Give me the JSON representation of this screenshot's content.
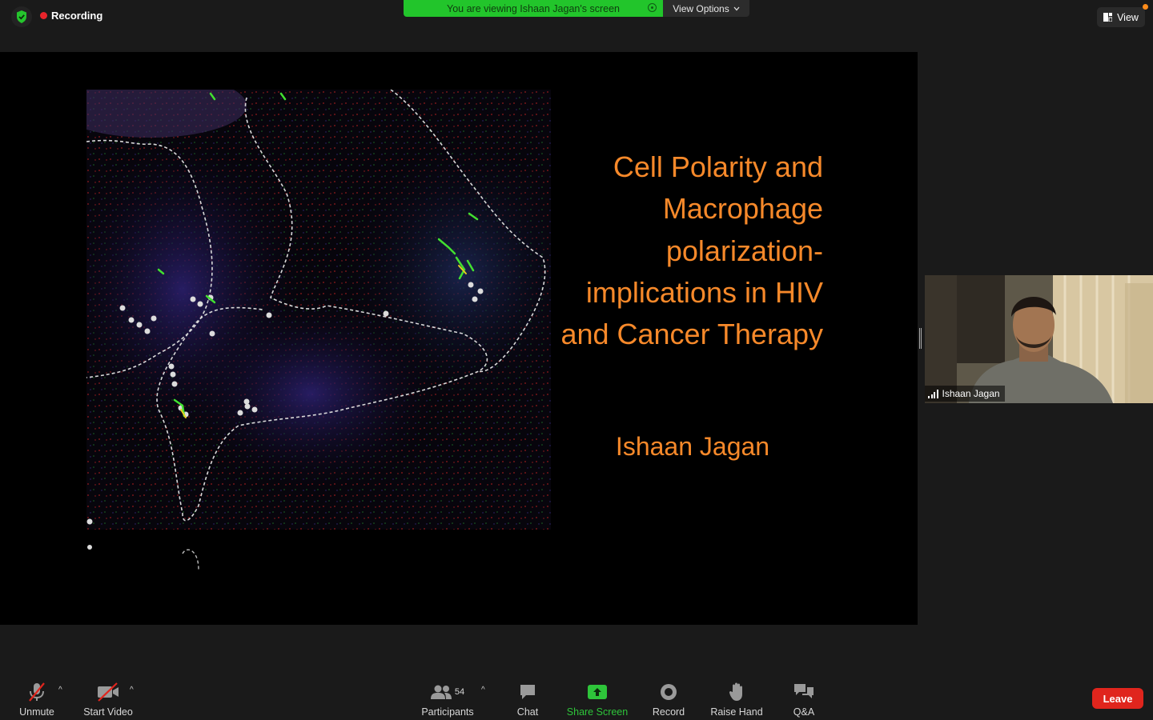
{
  "topbar": {
    "recording_label": "Recording",
    "viewing_banner": "You are viewing Ishaan Jagan's screen",
    "view_options_label": "View Options",
    "view_button_label": "View"
  },
  "slide": {
    "title_lines": [
      "Cell Polarity and",
      "Macrophage",
      "polarization-",
      "implications in HIV",
      "and Cancer Therapy"
    ],
    "author": "Ishaan Jagan"
  },
  "video": {
    "participant_name": "Ishaan Jagan"
  },
  "toolbar": {
    "unmute_label": "Unmute",
    "start_video_label": "Start Video",
    "participants_label": "Participants",
    "participants_count": "54",
    "chat_label": "Chat",
    "share_screen_label": "Share Screen",
    "record_label": "Record",
    "raise_hand_label": "Raise Hand",
    "qa_label": "Q&A",
    "leave_label": "Leave"
  },
  "colors": {
    "accent_green": "#22c52b",
    "leave_red": "#e0251d",
    "slide_text_orange": "#f7892a",
    "recording_red": "#e8242b"
  },
  "icons": [
    "shield-check-icon",
    "recording-dot-icon",
    "eye-icon",
    "chevron-down-icon",
    "view-grid-icon",
    "notification-dot-icon",
    "signal-bars-icon",
    "mic-muted-icon",
    "video-off-icon",
    "participants-icon",
    "chat-icon",
    "share-screen-icon",
    "record-icon",
    "raise-hand-icon",
    "qa-icon",
    "caret-up-icon"
  ]
}
